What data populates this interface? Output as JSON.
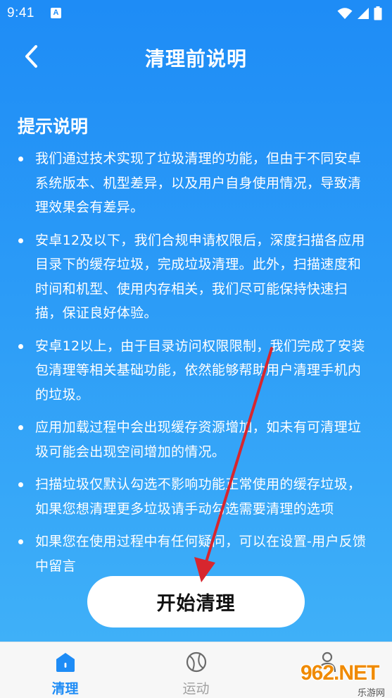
{
  "status_bar": {
    "time": "9:41",
    "notification_icon_letter": "A",
    "icons": [
      "wifi-icon",
      "signal-icon",
      "battery-icon"
    ]
  },
  "header": {
    "back_icon": "chevron-left-icon",
    "title": "清理前说明"
  },
  "section": {
    "heading": "提示说明",
    "tips": [
      "我们通过技术实现了垃圾清理的功能，但由于不同安卓系统版本、机型差异，以及用户自身使用情况，导致清理效果会有差异。",
      "安卓12及以下，我们合规申请权限后，深度扫描各应用目录下的缓存垃圾，完成垃圾清理。此外，扫描速度和时间和机型、使用内存相关，我们尽可能保持快速扫描，保证良好体验。",
      "安卓12以上，由于目录访问权限限制，我们完成了安装包清理等相关基础功能，依然能够帮助用户清理手机内的垃圾。",
      "应用加载过程中会出现缓存资源增加，如未有可清理垃圾可能会出现空间增加的情况。",
      "扫描垃圾仅默认勾选不影响功能正常使用的缓存垃圾，如果您想清理更多垃圾请手动勾选需要清理的选项",
      "如果您在使用过程中有任何疑问，可以在设置-用户反馈中留言"
    ]
  },
  "start_button": {
    "label": "开始清理"
  },
  "tab_bar": {
    "tabs": [
      {
        "label": "清理",
        "icon": "home-icon",
        "active": true
      },
      {
        "label": "运动",
        "icon": "ball-icon",
        "active": false
      },
      {
        "label": "",
        "icon": "profile-icon",
        "active": false
      }
    ]
  },
  "watermark": {
    "text": "962.NET",
    "sub": "乐游网"
  },
  "colors": {
    "primary": "#1e8cf6",
    "background_bottom": "#3fb0f8",
    "arrow": "#d7262e",
    "tab_inactive": "#a0a0a0"
  }
}
